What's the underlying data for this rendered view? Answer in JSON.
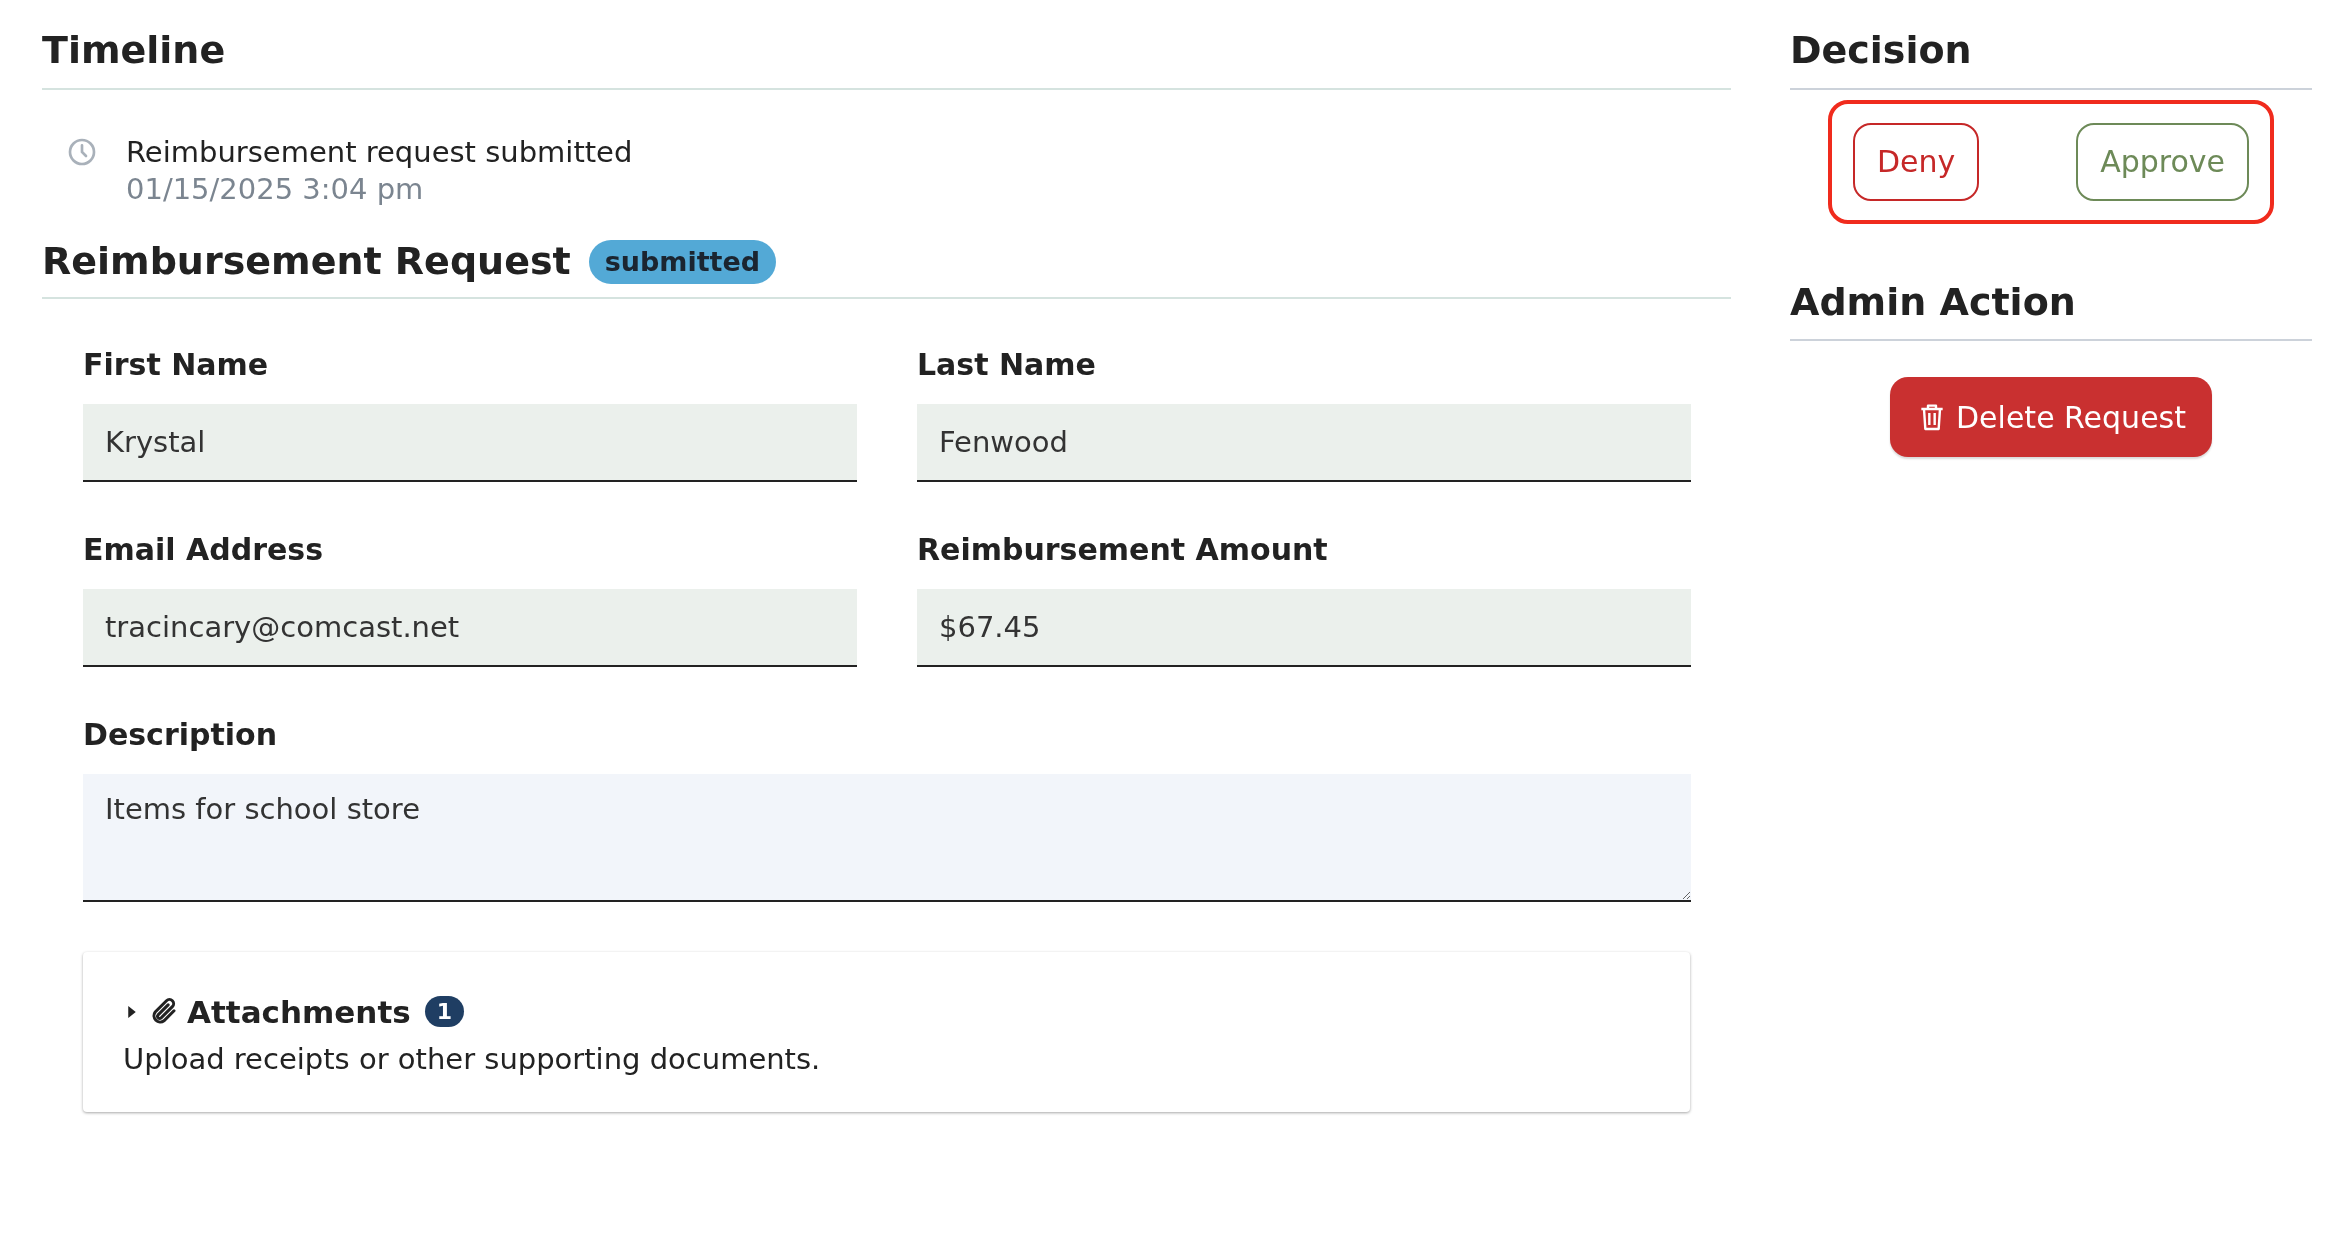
{
  "timeline": {
    "title": "Timeline",
    "events": [
      {
        "text": "Reimbursement request submitted",
        "time": "01/15/2025 3:04 pm"
      }
    ]
  },
  "request": {
    "title": "Reimbursement Request",
    "status": "submitted",
    "fields": [
      {
        "kind": "input",
        "label": "First Name",
        "value": "Krystal"
      },
      {
        "kind": "input",
        "label": "Last Name",
        "value": "Fenwood"
      },
      {
        "kind": "input",
        "label": "Email Address",
        "value": "tracincary@comcast.net"
      },
      {
        "kind": "input",
        "label": "Reimbursement Amount",
        "value": "$67.45"
      },
      {
        "kind": "textarea",
        "label": "Description",
        "value": "Items for school store"
      }
    ],
    "attachments": {
      "title": "Attachments",
      "count": "1",
      "expanded": false,
      "hint": "Upload receipts or other supporting documents."
    }
  },
  "decision": {
    "title": "Decision",
    "highlighted": true,
    "buttons": [
      {
        "kind": "deny",
        "label": "Deny"
      },
      {
        "kind": "approve",
        "label": "Approve"
      }
    ]
  },
  "admin": {
    "title": "Admin Action",
    "buttons": [
      {
        "kind": "delete",
        "label": "Delete Request"
      }
    ]
  }
}
